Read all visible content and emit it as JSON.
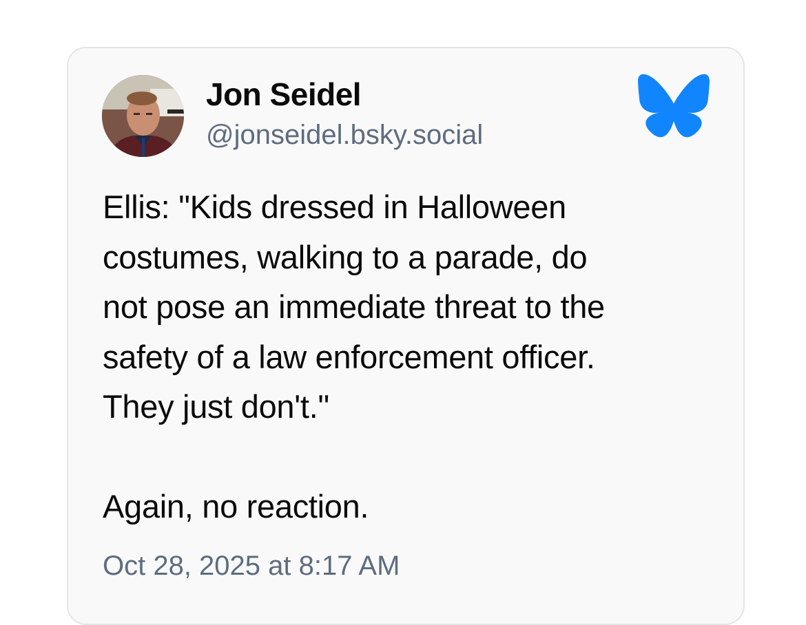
{
  "post": {
    "author": {
      "display_name": "Jon Seidel",
      "handle": "@jonseidel.bsky.social",
      "avatar_icon": "avatar-photo"
    },
    "platform_icon": "bluesky-butterfly-icon",
    "text": "Ellis: \"Kids dressed in Halloween\ncostumes, walking to a parade, do\nnot pose an immediate threat to the\nsafety of a law enforcement officer.\nThey just don't.\"\n\nAgain, no reaction.",
    "timestamp": "Oct 28, 2025 at 8:17 AM"
  },
  "colors": {
    "brand_blue": "#1185fe",
    "secondary_text": "#5d6c7e",
    "card_background": "#f9f9fa",
    "card_border": "#e4e5e7"
  }
}
